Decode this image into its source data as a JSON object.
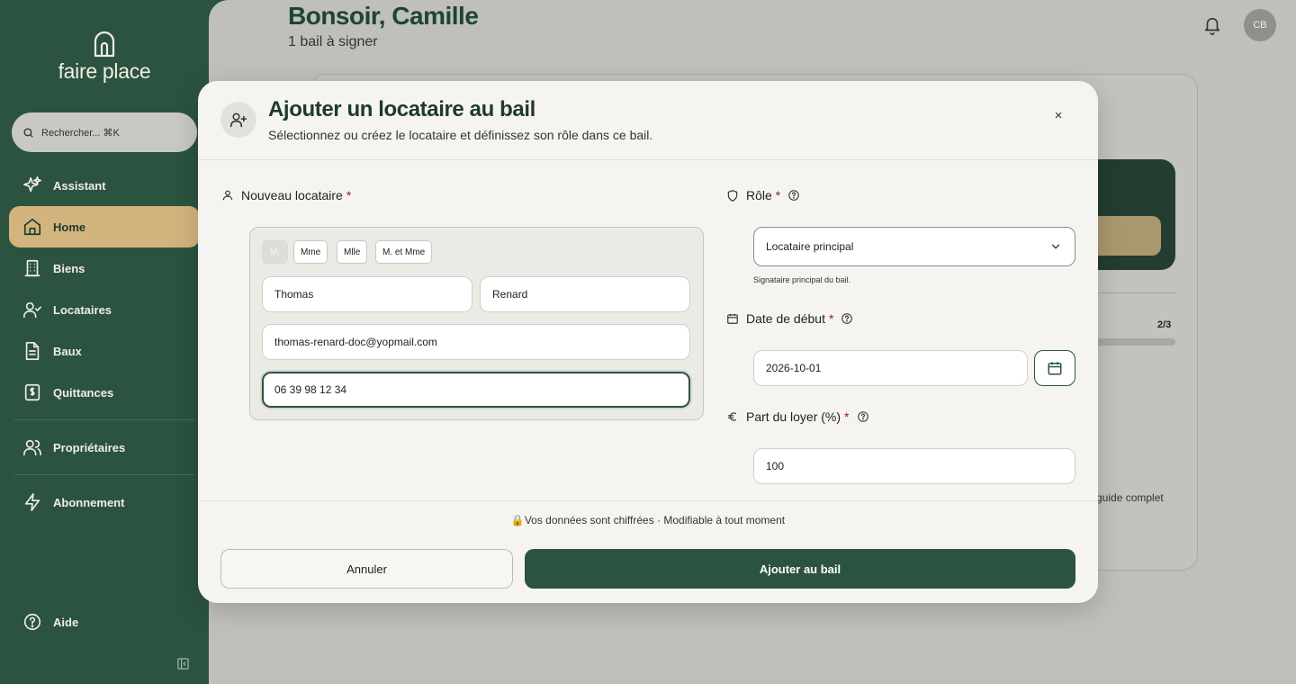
{
  "app": {
    "name": "faire place"
  },
  "sidebar": {
    "search_placeholder": "Rechercher... ⌘K",
    "items": [
      {
        "label": "Assistant",
        "icon": "sparkles-icon"
      },
      {
        "label": "Home",
        "icon": "home-icon",
        "active": true
      },
      {
        "label": "Biens",
        "icon": "building-icon"
      },
      {
        "label": "Locataires",
        "icon": "user-check-icon"
      },
      {
        "label": "Baux",
        "icon": "document-icon"
      },
      {
        "label": "Quittances",
        "icon": "receipt-icon"
      },
      {
        "label": "Propriétaires",
        "icon": "users-icon"
      },
      {
        "label": "Abonnement",
        "icon": "bolt-icon"
      },
      {
        "label": "Aide",
        "icon": "help-circle-icon"
      }
    ]
  },
  "header": {
    "greeting": "Bonsoir, Camille",
    "subtitle": "1 bail à signer",
    "avatar_initials": "CB"
  },
  "background": {
    "progress_label": "2/3",
    "guide_text": "guide complet"
  },
  "modal": {
    "title": "Ajouter un locataire au bail",
    "subtitle": "Sélectionnez ou créez le locataire et définissez son rôle dans ce bail.",
    "close_label": "×",
    "tenant_section": {
      "label": "Nouveau locataire",
      "required_mark": "*",
      "civilities": [
        "M.",
        "Mme",
        "Mlle",
        "M. et Mme"
      ],
      "selected_civility": "M.",
      "first_name": "Thomas",
      "last_name": "Renard",
      "email": "thomas-renard-doc@yopmail.com",
      "phone": "06 39 98 12 34"
    },
    "role": {
      "label": "Rôle",
      "required_mark": "*",
      "value": "Locataire principal",
      "hint": "Signataire principal du bail."
    },
    "start_date": {
      "label": "Date de début",
      "required_mark": "*",
      "value": "2026-10-01"
    },
    "rent_share": {
      "label": "Part du loyer (%)",
      "required_mark": "*",
      "value": "100"
    },
    "footer_note": "🔒Vos données sont chiffrées · Modifiable à tout moment",
    "cancel_label": "Annuler",
    "submit_label": "Ajouter au bail"
  },
  "colors": {
    "sidebar_bg": "#2b5340",
    "active_item": "#d3b47e",
    "primary": "#2b5340",
    "required": "#8b1d1d"
  }
}
